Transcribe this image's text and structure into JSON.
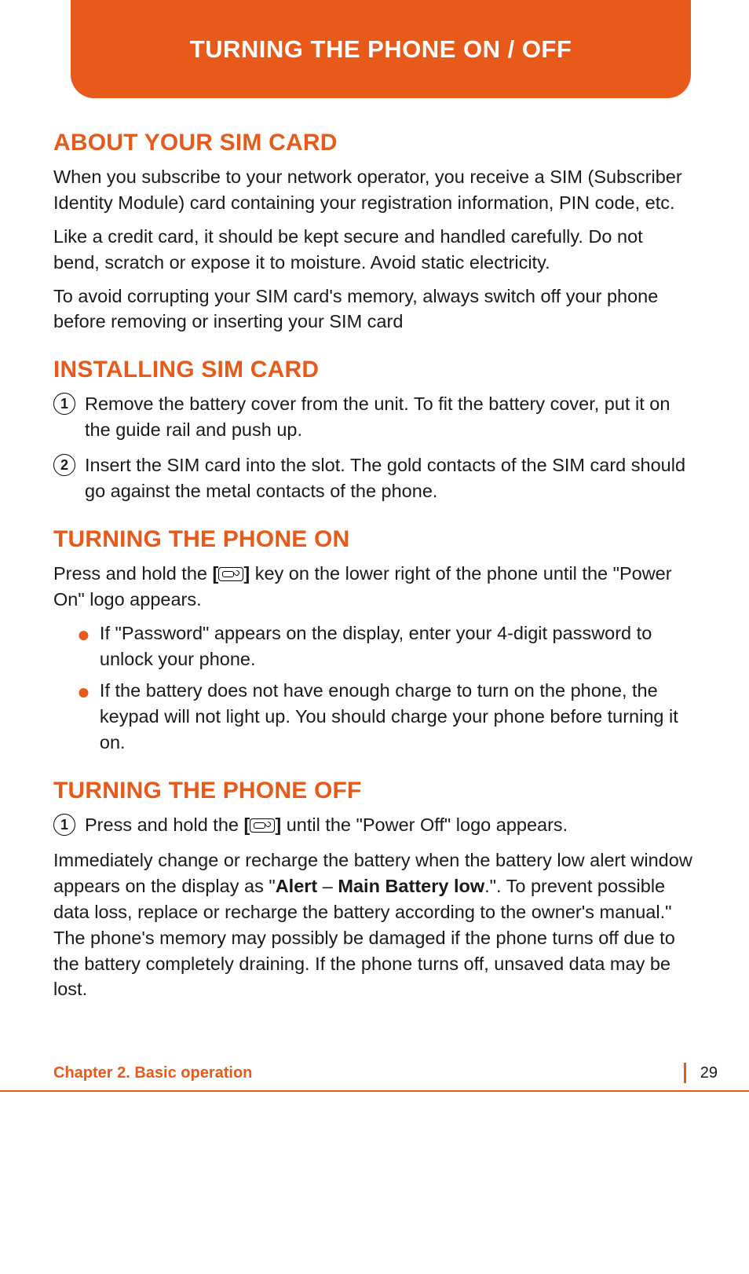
{
  "header": {
    "title": "TURNING THE PHONE ON / OFF"
  },
  "sections": {
    "about": {
      "heading": "ABOUT YOUR SIM CARD",
      "p1": "When you subscribe to your network operator, you receive a SIM (Subscriber Identity Module) card containing your registration information, PIN code, etc.",
      "p2": "Like a credit card, it should be kept secure and handled carefully. Do not bend, scratch or expose it to moisture. Avoid static electricity.",
      "p3": "To avoid corrupting your SIM card's memory, always switch off your phone before removing or inserting your SIM card"
    },
    "install": {
      "heading": "INSTALLING SIM CARD",
      "steps": [
        "Remove the battery cover from the unit. To fit the battery cover, put it on the guide rail and push up.",
        "Insert the SIM card into the slot. The gold contacts of the SIM card should go against the metal contacts of the phone."
      ]
    },
    "on": {
      "heading": "TURNING THE PHONE ON",
      "intro_pre": "Press and hold the ",
      "intro_key_open": "[",
      "intro_key_close": "] ",
      "intro_post": "key on the lower right of the phone until the \"Power On\" logo appears.",
      "bullets": [
        "If \"Password\" appears on the display, enter your 4-digit password to unlock your phone.",
        "If the battery does not have enough charge to turn on the phone, the keypad will not light up. You should charge your phone before turning it on."
      ]
    },
    "off": {
      "heading": "TURNING THE PHONE OFF",
      "step_pre": "Press and hold the ",
      "step_key_open": "[",
      "step_key_close": "] ",
      "step_post": "until the \"Power Off\" logo appears.",
      "closing_pre": "Immediately change or recharge the battery when the battery low alert window appears on the display as \"",
      "closing_bold1": "Alert",
      "closing_dash": " – ",
      "closing_bold2": "Main Battery low",
      "closing_post": ".\". To prevent possible data loss, replace or recharge the battery according to the owner's manual.\" The phone's memory may possibly be damaged if the phone turns off due to the battery completely draining. If the phone turns off, unsaved data may be lost."
    }
  },
  "footer": {
    "chapter": "Chapter 2. Basic operation",
    "page": "29"
  }
}
